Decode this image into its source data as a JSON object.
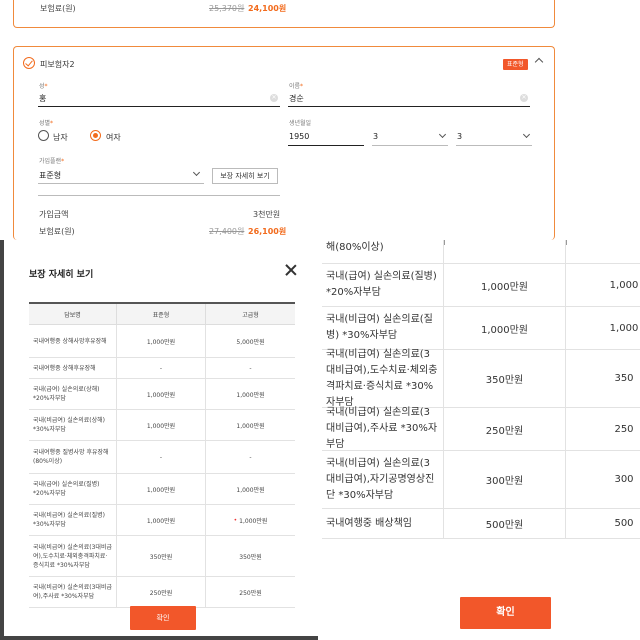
{
  "previous_insured": {
    "premium_label": "보험료(원)",
    "original_price": "25,370원",
    "discounted_price": "24,100원"
  },
  "insured": {
    "title": "피보험자2",
    "plan_badge": "표준형",
    "surname": {
      "label": "성",
      "value": "홍"
    },
    "given_name": {
      "label": "이름",
      "value": "경순"
    },
    "gender": {
      "label": "성별",
      "options": [
        "남자",
        "여자"
      ],
      "selected": "여자"
    },
    "birth": {
      "label": "생년월일",
      "year": "1950",
      "month": "3",
      "day": "3"
    },
    "plan": {
      "label": "가입플랜",
      "value": "표준형",
      "detail_button": "보장 자세히 보기"
    },
    "coverage_label": "가입금액",
    "coverage_value": "3천만원",
    "premium_label": "보험료(원)",
    "original_price": "27,400원",
    "discounted_price": "26,100원"
  },
  "modal": {
    "title": "보장 자세히 보기",
    "columns": [
      "담보명",
      "표준형",
      "고급형"
    ],
    "rows": [
      {
        "name": "국내여행중 상해사망후유장해",
        "standard": "1,000만원",
        "premium": "5,000만원"
      },
      {
        "name": "국내여행중 상해후유장해",
        "standard": "-",
        "premium": "-"
      },
      {
        "name": "국내(급여) 실손의료(상해) *20%자부담",
        "standard": "1,000만원",
        "premium": "1,000만원"
      },
      {
        "name": "국내(비급여) 실손의료(상해) *30%자부담",
        "standard": "1,000만원",
        "premium": "1,000만원"
      },
      {
        "name": "국내여행중 질병사망 후유장해(80%이상)",
        "standard": "-",
        "premium": "-"
      },
      {
        "name": "국내(급여) 실손의료(질병) *20%자부담",
        "standard": "1,000만원",
        "premium": "1,000만원"
      },
      {
        "name": "국내(비급여) 실손의료(질병) *30%자부담",
        "standard": "1,000만원",
        "premium": "1,000만원"
      },
      {
        "name": "국내(비급여) 실손의료(3대비급여),도수치료·체외충격파치료·증식치료 *30%자부담",
        "standard": "350만원",
        "premium": "350만원"
      },
      {
        "name": "국내(비급여) 실손의료(3대비급여),주사료 *30%자부담",
        "standard": "250만원",
        "premium": "250만원"
      }
    ],
    "confirm": "확인"
  },
  "zoom": {
    "top_fragment": "해(80%이상)",
    "rows": [
      {
        "name": "국내(급여) 실손의료(질병) *20%자부담",
        "standard": "1,000만원",
        "premium": "1,000"
      },
      {
        "name": "국내(비급여) 실손의료(질병) *30%자부담",
        "standard": "1,000만원",
        "premium": "1,000"
      },
      {
        "name": "국내(비급여) 실손의료(3대비급여),도수치료·체외충격파치료·증식치료 *30%자부담",
        "standard": "350만원",
        "premium": "350"
      },
      {
        "name": "국내(비급여) 실손의료(3대비급여),주사료 *30%자부담",
        "standard": "250만원",
        "premium": "250"
      },
      {
        "name": "국내(비급여) 실손의료(3대비급여),자기공명영상진단 *30%자부담",
        "standard": "300만원",
        "premium": "300"
      },
      {
        "name": "국내여행중 배상책임",
        "standard": "500만원",
        "premium": "500"
      }
    ],
    "confirm": "확인"
  },
  "colors": {
    "accent": "#f2572a",
    "price": "#f26b1d",
    "border": "#f08a3c"
  }
}
